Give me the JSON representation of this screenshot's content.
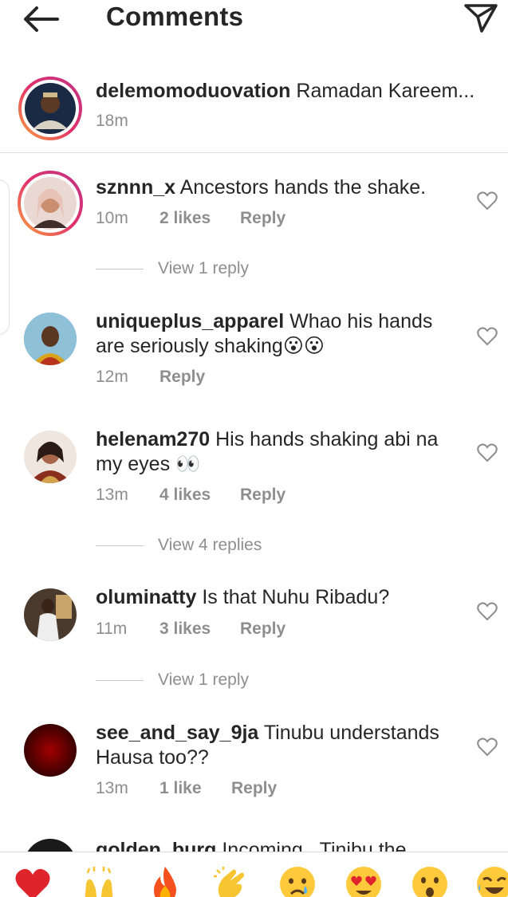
{
  "header": {
    "title": "Comments"
  },
  "caption": {
    "username": "delemomoduovation",
    "text": "Ramadan Kareem...",
    "time": "18m"
  },
  "comments": [
    {
      "username": "sznnn_x",
      "text": "Ancestors hands the shake.",
      "time": "10m",
      "likes": "2 likes",
      "reply": "Reply",
      "view_replies": "View 1 reply"
    },
    {
      "username": "uniqueplus_apparel",
      "text": "Whao his hands are seriously shaking😮😮",
      "time": "12m",
      "likes": "",
      "reply": "Reply",
      "view_replies": ""
    },
    {
      "username": "helenam270",
      "text": "His hands shaking abi na my eyes 👀",
      "time": "13m",
      "likes": "4 likes",
      "reply": "Reply",
      "view_replies": "View 4 replies"
    },
    {
      "username": "oluminatty",
      "text": "Is that Nuhu Ribadu?",
      "time": "11m",
      "likes": "3 likes",
      "reply": "Reply",
      "view_replies": "View 1 reply"
    },
    {
      "username": "see_and_say_9ja",
      "text": "Tinubu understands Hausa too??",
      "time": "13m",
      "likes": "1 like",
      "reply": "Reply",
      "view_replies": ""
    }
  ],
  "partial_comment": {
    "username": "golden_burg",
    "text": "Incoming...Tinibu the"
  },
  "emoji_bar": [
    "heart",
    "raising-hands",
    "fire",
    "clapping-hands",
    "crying-face",
    "heart-eyes-face",
    "surprised-face",
    "laughing-face"
  ],
  "colors": {
    "secondary_text": "#8e8e8e",
    "primary_text": "#262626",
    "heart_red": "#ed4956"
  }
}
